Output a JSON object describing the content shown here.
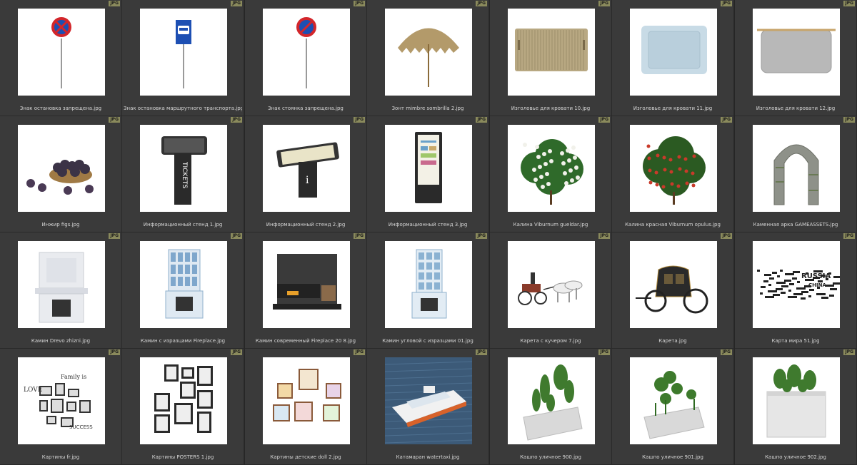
{
  "badge_text": "JPG",
  "items": [
    {
      "label": "Знак остановка запрещена.jpg",
      "icon": "no-stopping-sign-icon"
    },
    {
      "label": "Знак остановка маршрутного транспорта.jpg",
      "icon": "bus-stop-sign-icon"
    },
    {
      "label": "Знак стоянка запрещена.jpg",
      "icon": "no-parking-sign-icon"
    },
    {
      "label": "Зонт mimbre sombrilla 2.jpg",
      "icon": "straw-umbrella-icon"
    },
    {
      "label": "Изголовье для кровати 10.jpg",
      "icon": "headboard-beige-icon"
    },
    {
      "label": "Изголовье для кровати 11.jpg",
      "icon": "headboard-blue-icon"
    },
    {
      "label": "Изголовье для кровати 12.jpg",
      "icon": "headboard-grey-icon"
    },
    {
      "label": "Инжир figs.jpg",
      "icon": "figs-bowl-icon"
    },
    {
      "label": "Информационный стенд 1.jpg",
      "icon": "ticket-kiosk-icon"
    },
    {
      "label": "Информационный стенд 2.jpg",
      "icon": "info-table-kiosk-icon"
    },
    {
      "label": "Информационный стенд 3.jpg",
      "icon": "info-totem-icon"
    },
    {
      "label": "Калина Viburnum gueldar.jpg",
      "icon": "white-flower-bush-icon"
    },
    {
      "label": "Калина красная Viburnum opulus.jpg",
      "icon": "red-berry-bush-icon"
    },
    {
      "label": "Каменная арка GAMEASSETS.jpg",
      "icon": "stone-arch-icon"
    },
    {
      "label": "Камин Drevo zhizni.jpg",
      "icon": "white-fireplace-icon"
    },
    {
      "label": "Камин с изразцами Fireplace.jpg",
      "icon": "tiled-stove-icon"
    },
    {
      "label": "Камин современный Fireplace 20 8.jpg",
      "icon": "modern-fireplace-icon"
    },
    {
      "label": "Камин угловой с изразцами 01.jpg",
      "icon": "corner-tiled-stove-icon"
    },
    {
      "label": "Карета с кучером 7.jpg",
      "icon": "horse-carriage-icon"
    },
    {
      "label": "Карета.jpg",
      "icon": "carriage-icon"
    },
    {
      "label": "Карта мира 51.jpg",
      "icon": "word-world-map-icon"
    },
    {
      "label": "Картины fr.jpg",
      "icon": "picture-frames-words-icon"
    },
    {
      "label": "Картины POSTERS 1.jpg",
      "icon": "posters-gallery-icon"
    },
    {
      "label": "Картины детские doll 2.jpg",
      "icon": "kids-pictures-icon"
    },
    {
      "label": "Катамаран watertaxi.jpg",
      "icon": "catamaran-icon"
    },
    {
      "label": "Кашпо уличное 900.jpg",
      "icon": "planter-900-icon"
    },
    {
      "label": "Кашпо уличное 901.jpg",
      "icon": "planter-901-icon"
    },
    {
      "label": "Кашпо уличное 902.jpg",
      "icon": "planter-902-icon"
    }
  ]
}
